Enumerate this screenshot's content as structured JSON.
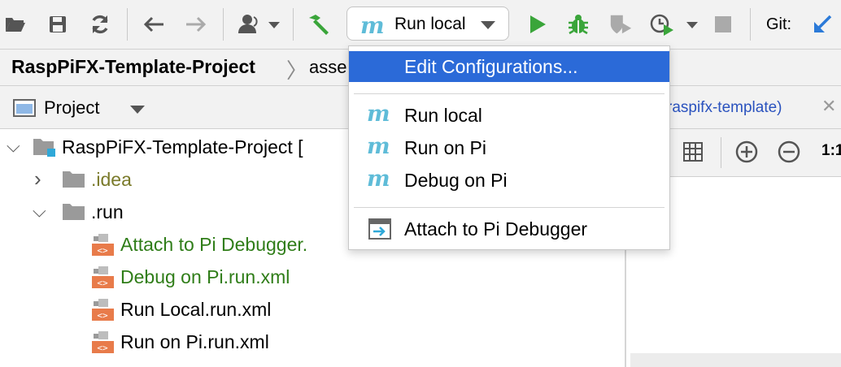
{
  "toolbar": {
    "run_config": "Run local",
    "git_label": "Git:"
  },
  "breadcrumb": {
    "project": "RaspPiFX-Template-Project",
    "folder": "asse"
  },
  "project_panel": {
    "title": "Project",
    "tree": [
      {
        "label": "RaspPiFX-Template-Project [",
        "indent": 0,
        "expanded": true,
        "kind": "module"
      },
      {
        "label": ".idea",
        "indent": 1,
        "expanded": false,
        "kind": "folder"
      },
      {
        "label": ".run",
        "indent": 1,
        "expanded": true,
        "kind": "folder"
      },
      {
        "label": "Attach to Pi Debugger.",
        "indent": 2,
        "kind": "xml",
        "color": "green"
      },
      {
        "label": "Debug on Pi.run.xml",
        "indent": 2,
        "kind": "xml",
        "color": "green"
      },
      {
        "label": "Run Local.run.xml",
        "indent": 2,
        "kind": "xml",
        "color": "normal"
      },
      {
        "label": "Run on Pi.run.xml",
        "indent": 2,
        "kind": "xml",
        "color": "normal"
      }
    ]
  },
  "editor": {
    "tab_label": "raspifx-template)",
    "zoom_label": "1:1"
  },
  "popup": {
    "edit_configurations": "Edit Configurations...",
    "items": [
      "Run local",
      "Run on Pi",
      "Debug on Pi"
    ],
    "attach": "Attach to Pi Debugger"
  },
  "colors": {
    "accent": "#2b6ad8",
    "run_green": "#3aa53a",
    "maven_blue": "#5fbcd8",
    "vcs_green": "#2f7d18"
  }
}
